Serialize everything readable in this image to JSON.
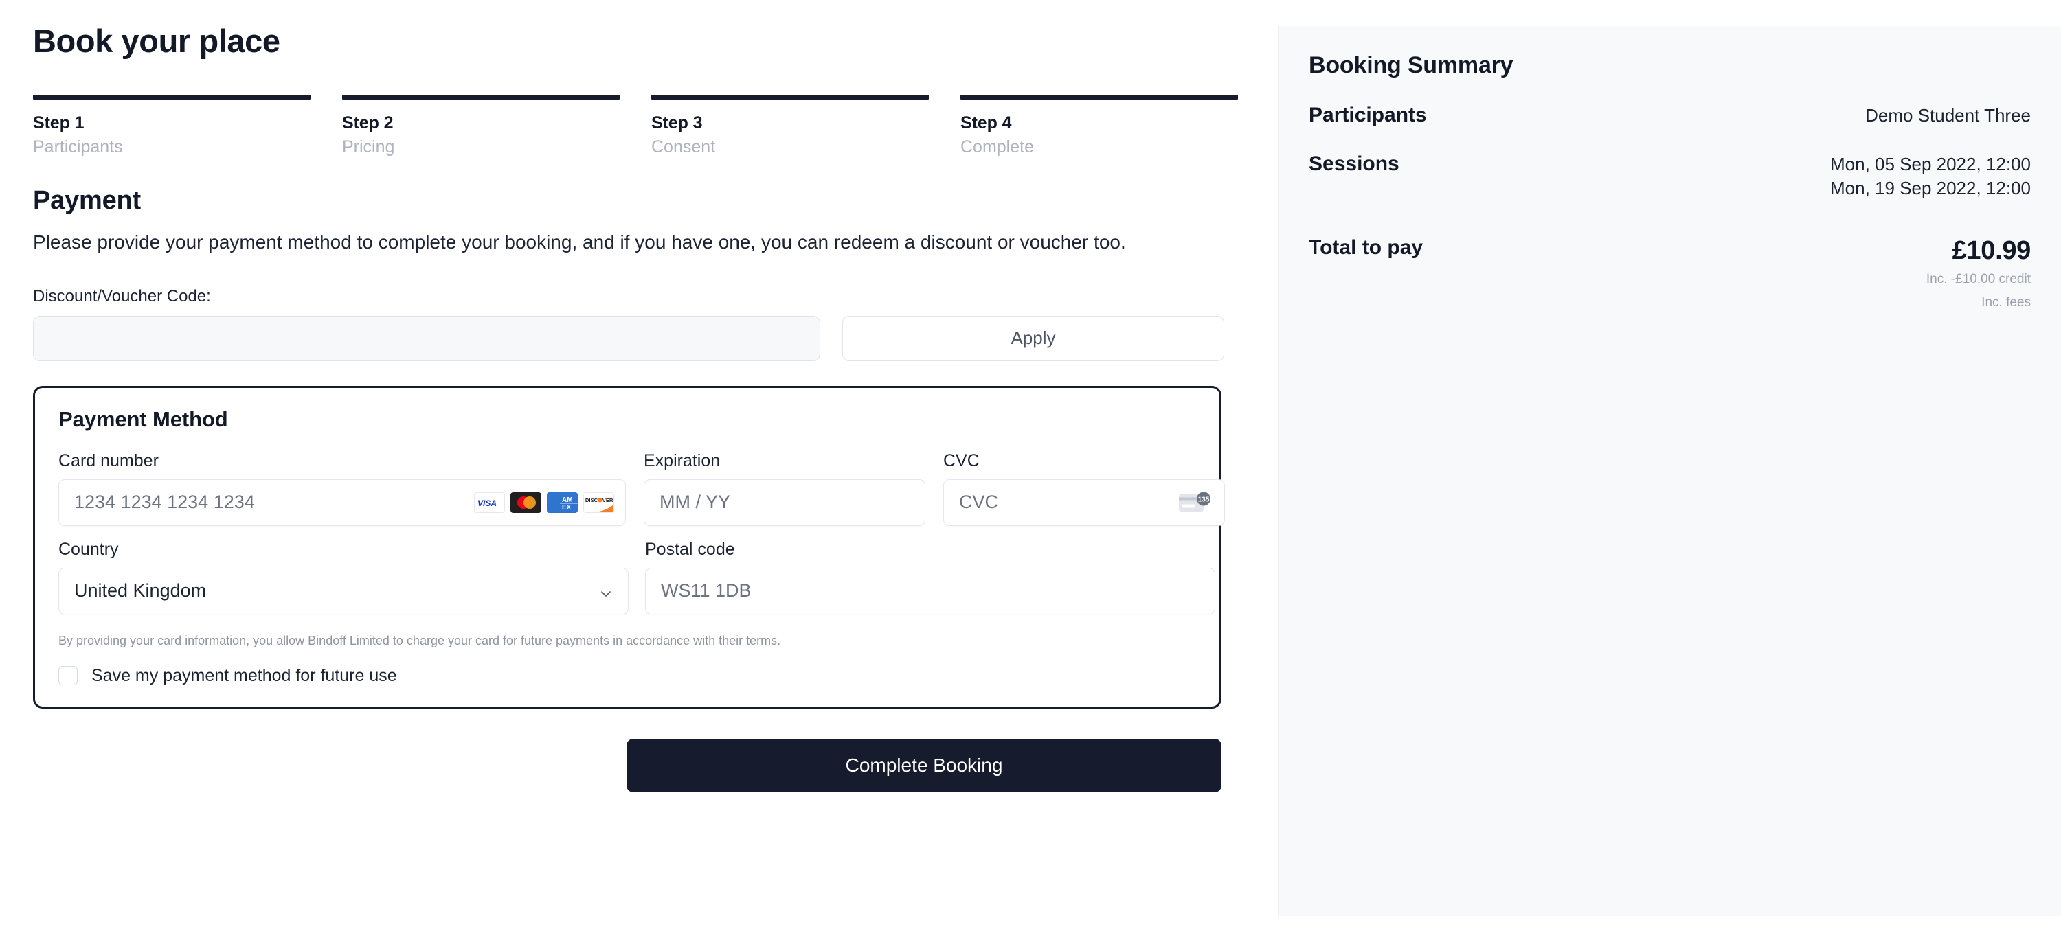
{
  "header": {
    "title": "Book your place"
  },
  "stepper": [
    {
      "title": "Step 1",
      "sub": "Participants"
    },
    {
      "title": "Step 2",
      "sub": "Pricing"
    },
    {
      "title": "Step 3",
      "sub": "Consent"
    },
    {
      "title": "Step 4",
      "sub": "Complete"
    }
  ],
  "payment": {
    "heading": "Payment",
    "description": "Please provide your payment method to complete your booking, and if you have one, you can redeem a discount or voucher too.",
    "discount_label": "Discount/Voucher Code:",
    "discount_value": "",
    "discount_placeholder": "",
    "apply_label": "Apply"
  },
  "payment_method": {
    "title": "Payment Method",
    "card_number_label": "Card number",
    "card_number_placeholder": "1234 1234 1234 1234",
    "card_number_value": "",
    "expiration_label": "Expiration",
    "expiration_placeholder": "MM / YY",
    "expiration_value": "",
    "cvc_label": "CVC",
    "cvc_placeholder": "CVC",
    "cvc_value": "",
    "cvc_icon_digits": "135",
    "country_label": "Country",
    "country_value": "United Kingdom",
    "country_options": [
      "United Kingdom"
    ],
    "postal_label": "Postal code",
    "postal_placeholder": "WS11 1DB",
    "postal_value": "",
    "brands": [
      "visa-icon",
      "mastercard-icon",
      "amex-icon",
      "discover-icon"
    ],
    "brand_labels": {
      "visa": "VISA",
      "amex_top": "AM",
      "amex_bottom": "EX",
      "discover": "DISC VER"
    },
    "disclaimer": "By providing your card information, you allow Bindoff Limited to charge your card for future payments in accordance with their terms.",
    "save_method_label": "Save my payment method for future use",
    "save_method_checked": false
  },
  "actions": {
    "complete_label": "Complete Booking"
  },
  "summary": {
    "title": "Booking Summary",
    "participants_label": "Participants",
    "participants_value": "Demo Student Three",
    "sessions_label": "Sessions",
    "sessions_values": [
      "Mon, 05 Sep 2022, 12:00",
      "Mon, 19 Sep 2022, 12:00"
    ],
    "total_label": "Total to pay",
    "total_value": "£10.99",
    "total_note_credit": "Inc. -£10.00 credit",
    "total_note_fees": "Inc. fees"
  },
  "colors": {
    "ink": "#161c2d",
    "muted": "#aeb3bf",
    "panel_bg": "#f8f9fb",
    "field_border": "#e4e7ee",
    "visa_blue": "#1a1f71",
    "mc_red": "#eb001b",
    "mc_orange": "#f79e1b",
    "amex_blue": "#2f75cf",
    "discover_orange": "#f48024"
  }
}
